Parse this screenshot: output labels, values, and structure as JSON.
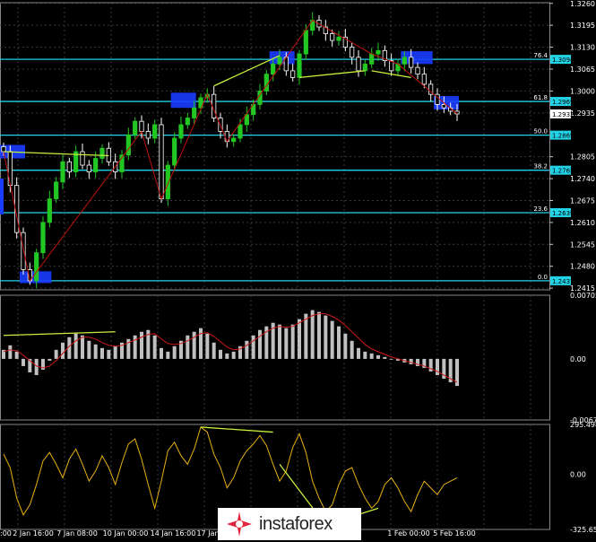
{
  "colors": {
    "background": "#000000",
    "bull": "#22c722",
    "bear": "#ffffff",
    "fib_line": "#22d3e6",
    "zigzag": "#c01010",
    "trendline": "#c8f03c",
    "histogram": "#c0c0c0",
    "signal": "#d01818",
    "cci": "#e8b010",
    "zone": "#1a3cff",
    "grid": "#3a3a3a"
  },
  "chart_data": [
    {
      "type": "candlestick",
      "symbol_hint": "GBP/USD H4",
      "y_ticks": [
        "1.3260",
        "1.3195",
        "1.3130",
        "1.3065",
        "1.3000",
        "1.2935",
        "1.2805",
        "1.2740",
        "1.2675",
        "1.2610",
        "1.2545",
        "1.2480",
        "1.2415"
      ],
      "ylim": [
        1.241,
        1.3262
      ],
      "current_price": "1.2932",
      "fib_levels": [
        {
          "label": "76.4",
          "value": "1.3094"
        },
        {
          "label": "61.8",
          "value": "1.2969"
        },
        {
          "label": "50.0",
          "value": "1.2869"
        },
        {
          "label": "38.2",
          "value": "1.2765"
        },
        {
          "label": "23.6",
          "value": "1.2639"
        },
        {
          "label": "0.0",
          "value": "1.2437"
        }
      ],
      "x_labels": [
        ":00",
        "2 Jan 16:00",
        "7 Jan 08:00",
        "10 Jan 00:00",
        "14 Jan 16:00",
        "17 Jan",
        "1 Feb 00:00",
        "5 Feb 16:00"
      ],
      "series": [
        {
          "values": [
            1.282,
            1.272,
            1.258,
            1.247,
            1.2437,
            1.252,
            1.261,
            1.268,
            1.273,
            1.279,
            1.276,
            1.282,
            1.278,
            1.276,
            1.28,
            1.283,
            1.279,
            1.276,
            1.281,
            1.287,
            1.291,
            1.288,
            1.286,
            1.29,
            1.268,
            1.278,
            1.286,
            1.29,
            1.292,
            1.295,
            1.298,
            1.299,
            1.292,
            1.288,
            1.285,
            1.286,
            1.29,
            1.293,
            1.296,
            1.3,
            1.305,
            1.308,
            1.31,
            1.306,
            1.304,
            1.311,
            1.318,
            1.321,
            1.319,
            1.317,
            1.315,
            1.316,
            1.313,
            1.31,
            1.306,
            1.308,
            1.311,
            1.312,
            1.309,
            1.306,
            1.308,
            1.31,
            1.307,
            1.305,
            1.302,
            1.299,
            1.296,
            1.295,
            1.294,
            1.2932
          ]
        }
      ]
    },
    {
      "type": "bar",
      "indicator": "MACD histogram with signal line",
      "y_ticks": [
        "0.00705",
        "0.00",
        "-0.00677"
      ],
      "ylim": [
        -0.00677,
        0.00705
      ],
      "series": [
        {
          "values": [
            0.001,
            0.0015,
            0.0008,
            -0.0008,
            -0.0015,
            -0.0018,
            -0.0012,
            -0.0002,
            0.001,
            0.0018,
            0.0024,
            0.0028,
            0.0026,
            0.002,
            0.0016,
            0.0012,
            0.001,
            0.0014,
            0.0018,
            0.0022,
            0.0026,
            0.003,
            0.0032,
            0.0026,
            0.0012,
            0.0008,
            0.0014,
            0.002,
            0.0026,
            0.003,
            0.0034,
            0.0028,
            0.0018,
            0.001,
            0.0006,
            0.0008,
            0.0014,
            0.002,
            0.0026,
            0.0032,
            0.0036,
            0.004,
            0.0038,
            0.0034,
            0.0038,
            0.0044,
            0.005,
            0.0054,
            0.0052,
            0.0048,
            0.0042,
            0.0036,
            0.0028,
            0.002,
            0.0012,
            0.0008,
            0.0006,
            0.0004,
            0.0002,
            0.0,
            -0.0002,
            -0.0004,
            -0.0006,
            -0.0008,
            -0.001,
            -0.0014,
            -0.0018,
            -0.0022,
            -0.0026,
            -0.003
          ]
        },
        {
          "values": [
            0.0008,
            0.001,
            0.0009,
            0.0004,
            -0.0002,
            -0.0008,
            -0.001,
            -0.0008,
            -0.0002,
            0.0006,
            0.0014,
            0.002,
            0.0024,
            0.0024,
            0.0022,
            0.0018,
            0.0015,
            0.0014,
            0.0015,
            0.0018,
            0.0021,
            0.0024,
            0.0027,
            0.0028,
            0.0022,
            0.0017,
            0.0016,
            0.0017,
            0.002,
            0.0024,
            0.0028,
            0.0029,
            0.0025,
            0.0019,
            0.0013,
            0.001,
            0.0011,
            0.0015,
            0.002,
            0.0025,
            0.003,
            0.0034,
            0.0036,
            0.0035,
            0.0036,
            0.004,
            0.0044,
            0.0048,
            0.005,
            0.005,
            0.0047,
            0.0043,
            0.0037,
            0.003,
            0.0023,
            0.0016,
            0.0011,
            0.0008,
            0.0005,
            0.0002,
            0.0,
            -0.0002,
            -0.0004,
            -0.0006,
            -0.0008,
            -0.0011,
            -0.0014,
            -0.0018,
            -0.0022,
            -0.0026
          ]
        }
      ]
    },
    {
      "type": "line",
      "indicator": "CCI",
      "y_ticks": [
        "295.4989",
        "0.00",
        "-325.6595"
      ],
      "ylim": [
        -325.6595,
        295.4989
      ],
      "series": [
        {
          "values": [
            120,
            40,
            -140,
            -240,
            -180,
            -60,
            80,
            130,
            60,
            -20,
            90,
            150,
            60,
            -40,
            20,
            110,
            40,
            -60,
            70,
            180,
            210,
            90,
            -60,
            -200,
            -40,
            140,
            190,
            110,
            60,
            150,
            280,
            250,
            120,
            40,
            -80,
            -20,
            80,
            140,
            180,
            230,
            170,
            60,
            -40,
            20,
            160,
            240,
            130,
            -40,
            -140,
            -220,
            -180,
            -60,
            20,
            40,
            -60,
            -140,
            -200,
            -160,
            -60,
            -20,
            -80,
            -160,
            -220,
            -120,
            -40,
            -80,
            -120,
            -60,
            -40,
            -20
          ]
        }
      ]
    }
  ],
  "watermark": {
    "text": "instaforex"
  }
}
